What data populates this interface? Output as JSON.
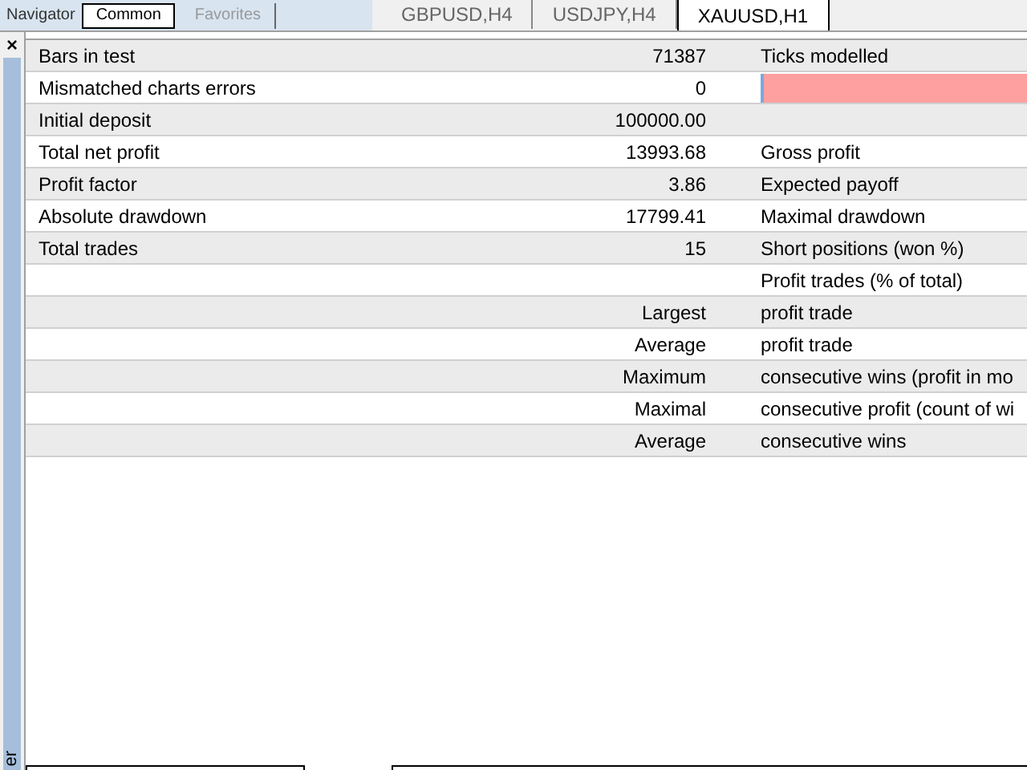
{
  "navigator": {
    "title": "Navigator",
    "tabs": [
      {
        "label": "Common",
        "selected": true
      },
      {
        "label": "Favorites",
        "selected": false
      }
    ]
  },
  "chart_tabs": [
    {
      "label": "GBPUSD,H4",
      "selected": false
    },
    {
      "label": "USDJPY,H4",
      "selected": false
    },
    {
      "label": "XAUUSD,H1",
      "selected": true
    }
  ],
  "side_panel": {
    "close": "×",
    "caption": "er"
  },
  "report": {
    "rows": [
      {
        "label": "Bars in test",
        "value": "71387",
        "label_2": "Ticks modelled",
        "highlight": false
      },
      {
        "label": "Mismatched charts errors",
        "value": "0",
        "highlight": true
      },
      {
        "label": "Initial deposit",
        "value": "100000.00",
        "highlight": false
      },
      {
        "label": "Total net profit",
        "value": "13993.68",
        "label_2": "Gross profit",
        "highlight": false
      },
      {
        "label": "Profit factor",
        "value": "3.86",
        "label_2": "Expected payoff",
        "highlight": false
      },
      {
        "label": "Absolute drawdown",
        "value": "17799.41",
        "label_2": "Maximal drawdown",
        "highlight": false
      },
      {
        "label": "Total trades",
        "value": "15",
        "label_2": "Short positions (won %)",
        "highlight": false
      },
      {
        "label_2": "Profit trades (% of total)",
        "highlight": false
      },
      {
        "value": "Largest",
        "label_2": "profit trade",
        "highlight": false
      },
      {
        "value": "Average",
        "label_2": "profit trade",
        "highlight": false
      },
      {
        "value": "Maximum",
        "label_2": "consecutive wins (profit in mo",
        "highlight": false
      },
      {
        "value": "Maximal",
        "label_2": "consecutive profit (count of wi",
        "highlight": false
      },
      {
        "value": "Average",
        "label_2": "consecutive wins",
        "highlight": false
      }
    ]
  }
}
